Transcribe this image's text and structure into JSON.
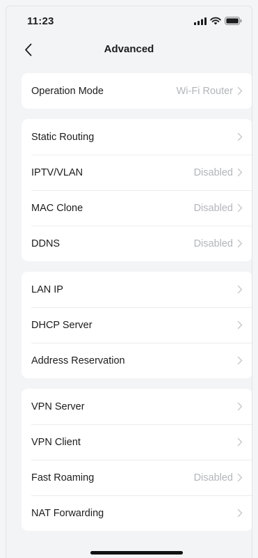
{
  "status": {
    "time": "11:23"
  },
  "nav": {
    "title": "Advanced"
  },
  "groups": [
    {
      "rows": [
        {
          "label": "Operation Mode",
          "value": "Wi-Fi Router"
        }
      ]
    },
    {
      "rows": [
        {
          "label": "Static Routing",
          "value": ""
        },
        {
          "label": "IPTV/VLAN",
          "value": "Disabled"
        },
        {
          "label": "MAC Clone",
          "value": "Disabled"
        },
        {
          "label": "DDNS",
          "value": "Disabled"
        }
      ]
    },
    {
      "rows": [
        {
          "label": "LAN IP",
          "value": ""
        },
        {
          "label": "DHCP Server",
          "value": ""
        },
        {
          "label": "Address Reservation",
          "value": ""
        }
      ]
    },
    {
      "rows": [
        {
          "label": "VPN Server",
          "value": ""
        },
        {
          "label": "VPN Client",
          "value": ""
        },
        {
          "label": "Fast Roaming",
          "value": "Disabled"
        },
        {
          "label": "NAT Forwarding",
          "value": ""
        }
      ]
    }
  ],
  "icons": {
    "back": "chevron-left-icon",
    "row_arrow": "chevron-right-icon",
    "signal": "cellular-signal-icon",
    "wifi": "wifi-icon",
    "battery": "battery-icon"
  }
}
